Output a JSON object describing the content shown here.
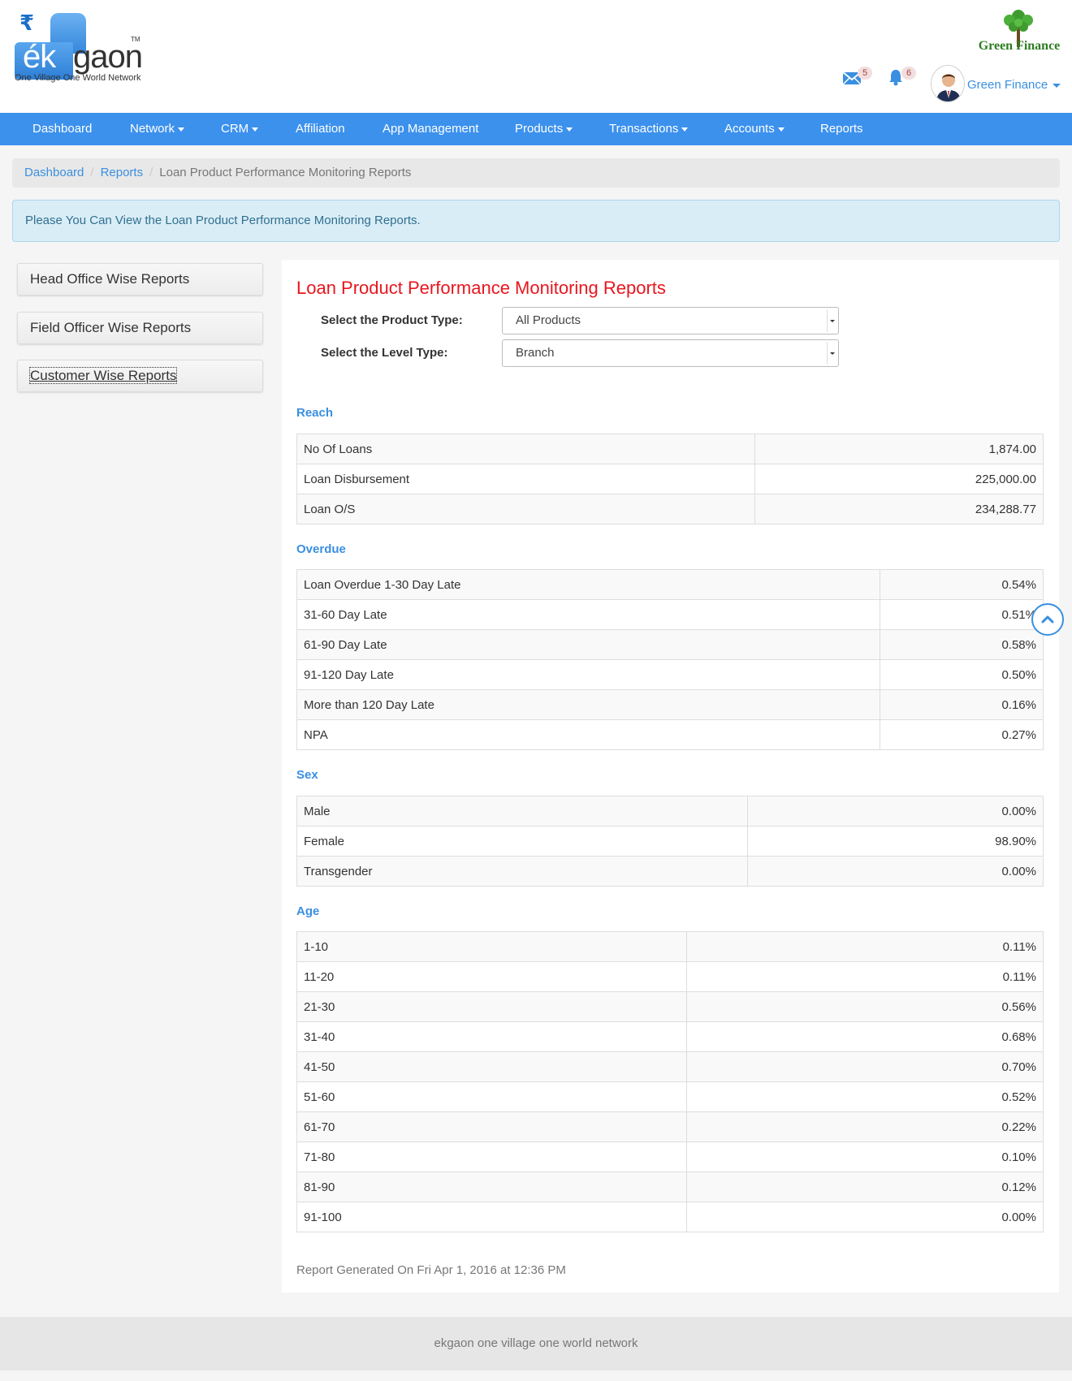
{
  "brand": {
    "rupee_symbol": "₹",
    "logo_ek": "ék",
    "logo_gaon": "gaon",
    "logo_tm": "TM",
    "tagline": "One Village One World Network",
    "partner_logo_text": "Green Finance"
  },
  "header": {
    "mail_count": "5",
    "notification_count": "6",
    "user_name": "Green Finance"
  },
  "nav": {
    "items": [
      {
        "label": "Dashboard"
      },
      {
        "label": "Network"
      },
      {
        "label": "CRM"
      },
      {
        "label": "Affiliation"
      },
      {
        "label": "App Management"
      },
      {
        "label": "Products"
      },
      {
        "label": "Transactions"
      },
      {
        "label": "Accounts"
      },
      {
        "label": "Reports"
      }
    ]
  },
  "breadcrumb": {
    "items": [
      "Dashboard",
      "Reports"
    ],
    "active": "Loan Product Performance Monitoring Reports"
  },
  "alert": {
    "message": "Please You Can View the Loan Product Performance Monitoring Reports."
  },
  "sidebar": {
    "items": [
      {
        "label": "Head Office Wise Reports"
      },
      {
        "label": "Field Officer Wise Reports"
      },
      {
        "label": "Customer Wise Reports"
      }
    ]
  },
  "main": {
    "title": "Loan Product Performance Monitoring Reports",
    "product_type_label": "Select the Product Type:",
    "product_type_value": "All Products",
    "level_type_label": "Select the Level Type:",
    "level_type_value": "Branch",
    "sections": {
      "reach": {
        "heading": "Reach",
        "rows": [
          {
            "label": "No Of Loans",
            "value": "1,874.00"
          },
          {
            "label": "Loan Disbursement",
            "value": "225,000.00"
          },
          {
            "label": "Loan O/S",
            "value": "234,288.77"
          }
        ]
      },
      "overdue": {
        "heading": "Overdue",
        "rows": [
          {
            "label": "Loan Overdue 1-30 Day Late",
            "value": "0.54%"
          },
          {
            "label": "31-60 Day Late",
            "value": "0.51%"
          },
          {
            "label": "61-90 Day Late",
            "value": "0.58%"
          },
          {
            "label": "91-120 Day Late",
            "value": "0.50%"
          },
          {
            "label": "More than 120 Day Late",
            "value": "0.16%"
          },
          {
            "label": "NPA",
            "value": "0.27%"
          }
        ]
      },
      "sex": {
        "heading": "Sex",
        "rows": [
          {
            "label": "Male",
            "value": "0.00%"
          },
          {
            "label": "Female",
            "value": "98.90%"
          },
          {
            "label": "Transgender",
            "value": "0.00%"
          }
        ]
      },
      "age": {
        "heading": "Age",
        "rows": [
          {
            "label": "1-10",
            "value": "0.11%"
          },
          {
            "label": "11-20",
            "value": "0.11%"
          },
          {
            "label": "21-30",
            "value": "0.56%"
          },
          {
            "label": "31-40",
            "value": "0.68%"
          },
          {
            "label": "41-50",
            "value": "0.70%"
          },
          {
            "label": "51-60",
            "value": "0.52%"
          },
          {
            "label": "61-70",
            "value": "0.22%"
          },
          {
            "label": "71-80",
            "value": "0.10%"
          },
          {
            "label": "81-90",
            "value": "0.12%"
          },
          {
            "label": "91-100",
            "value": "0.00%"
          }
        ]
      }
    },
    "generated_text": "Report Generated On Fri Apr 1, 2016 at 12:36 PM"
  },
  "footer": {
    "text": "ekgaon one village one world network"
  },
  "colors": {
    "nav_bg": "#3c91ed",
    "title_red": "#e8161e",
    "section_blue": "#3a8fe0",
    "alert_bg": "#d9edf7"
  },
  "icons": {
    "mail": "envelope-icon",
    "bell": "bell-icon",
    "avatar": "user-avatar-icon",
    "scroll_top": "chevron-up-icon"
  }
}
